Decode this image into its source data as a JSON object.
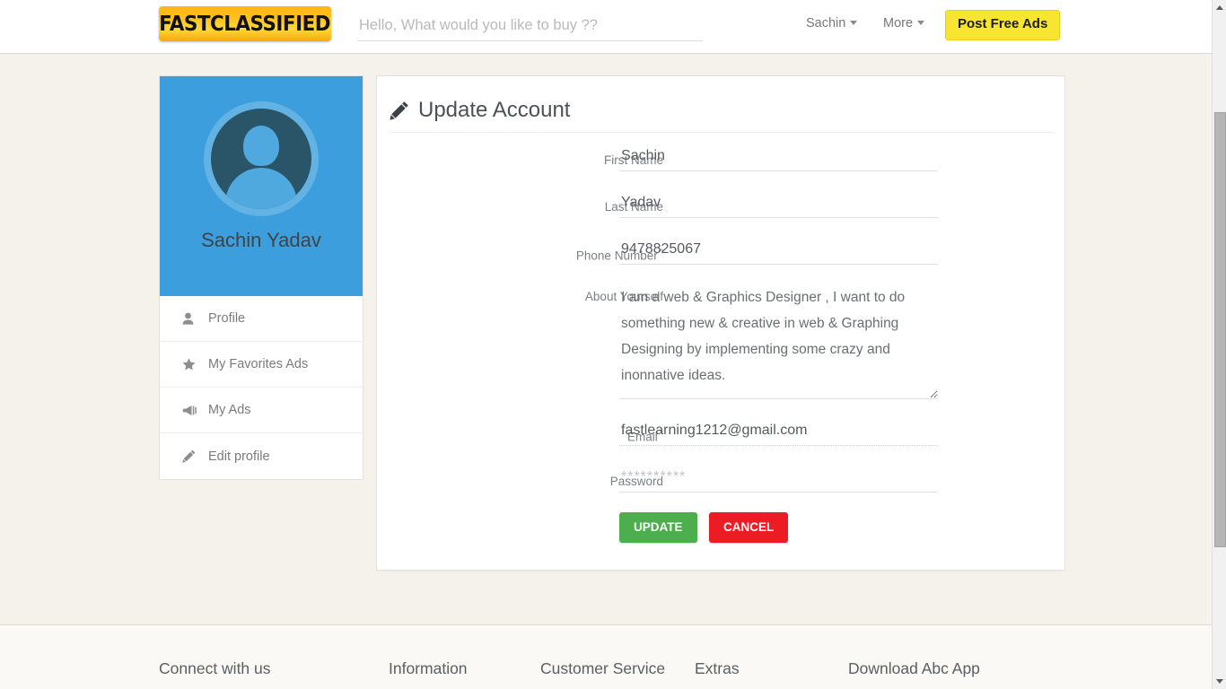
{
  "header": {
    "logo_text": "FASTCLASSIFIED",
    "search": {
      "placeholder": "Hello, What would you like to buy ??",
      "value": "",
      "icon": "search-icon"
    },
    "nav": [
      {
        "label": "Sachin",
        "icon": "chevron-down-icon"
      },
      {
        "label": "More",
        "icon": "chevron-down-icon"
      }
    ],
    "post_button": "Post Free Ads"
  },
  "sidebar": {
    "profile_name": "Sachin Yadav",
    "avatar_icon": "user-avatar-icon",
    "items": [
      {
        "label": "Profile",
        "icon": "user-icon"
      },
      {
        "label": "My Favorites Ads",
        "icon": "star-icon"
      },
      {
        "label": "My Ads",
        "icon": "bullhorn-icon"
      },
      {
        "label": "Edit profile",
        "icon": "pencil-icon"
      }
    ]
  },
  "main": {
    "title": "Update Account",
    "title_icon": "pencil-icon",
    "fields": {
      "first_name": {
        "label": "First Name",
        "value": "Sachin",
        "required": false,
        "placeholder": ""
      },
      "last_name": {
        "label": "Last Name",
        "value": "Yadav",
        "required": false,
        "placeholder": ""
      },
      "phone_number": {
        "label": "Phone Number",
        "value": "9478825067",
        "required": true,
        "required_mark": "*",
        "placeholder": ""
      },
      "about_yourself": {
        "label": "About Yourself",
        "value": "I am a web & Graphics Designer , I want to do something new & creative in web & Graphing Designing by implementing some crazy and inonnative ideas.",
        "required": false,
        "placeholder": ""
      },
      "email": {
        "label": "Email",
        "value": "fastlearning1212@gmail.com",
        "required": true,
        "required_mark": "*",
        "placeholder": ""
      },
      "password": {
        "label": "Password",
        "value": "",
        "required": false,
        "placeholder": "**********"
      }
    },
    "buttons": {
      "update": "UPDATE",
      "cancel": "CANCEL"
    }
  },
  "footer": {
    "columns": [
      "Connect with us",
      "Information",
      "Customer Service",
      "Extras",
      "Download Abc App"
    ]
  },
  "colors": {
    "page_background": "#f5f2eb",
    "sidebar_blue": "#3d9edd",
    "accent_yellow": "#f7e52f",
    "update_green": "#4cae4c",
    "cancel_red": "#ec1c24",
    "logo_orange": "#ffb416"
  }
}
